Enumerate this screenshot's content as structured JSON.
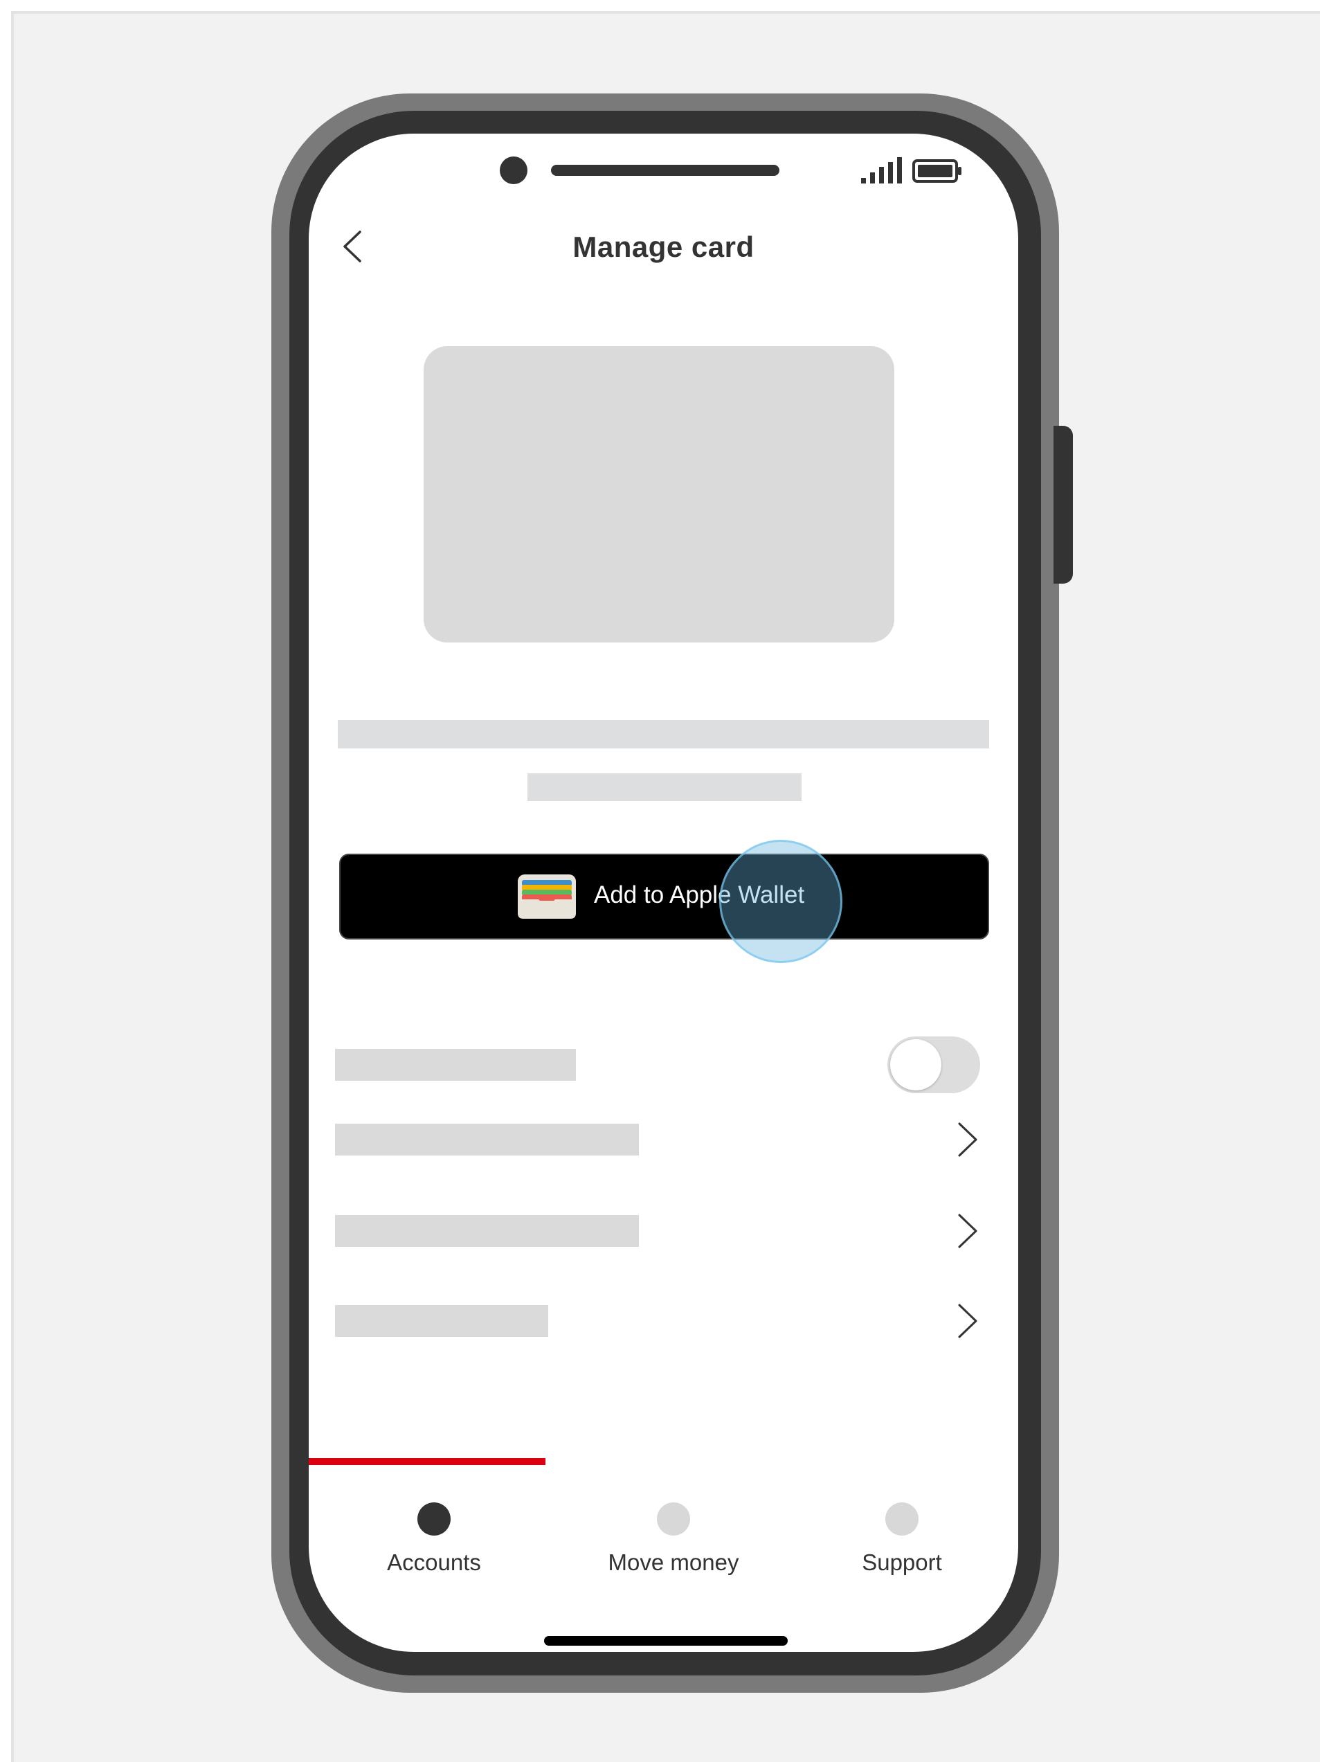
{
  "header": {
    "title": "Manage card"
  },
  "wallet_button": {
    "label": "Add to Apple Wallet"
  },
  "settings": {
    "toggle_on": false
  },
  "tabs": [
    {
      "label": "Accounts",
      "active": true
    },
    {
      "label": "Move money",
      "active": false
    },
    {
      "label": "Support",
      "active": false
    }
  ],
  "colors": {
    "accent_red": "#db0011",
    "active_tab_dot": "#333333",
    "inactive_tab_dot": "#d8d8d8",
    "wallet_button_bg": "#000000"
  },
  "icons": {
    "back": "chevron-left-icon",
    "signal": "signal-icon",
    "battery": "battery-icon",
    "wallet": "apple-wallet-icon",
    "row_chevron": "chevron-right-icon"
  }
}
